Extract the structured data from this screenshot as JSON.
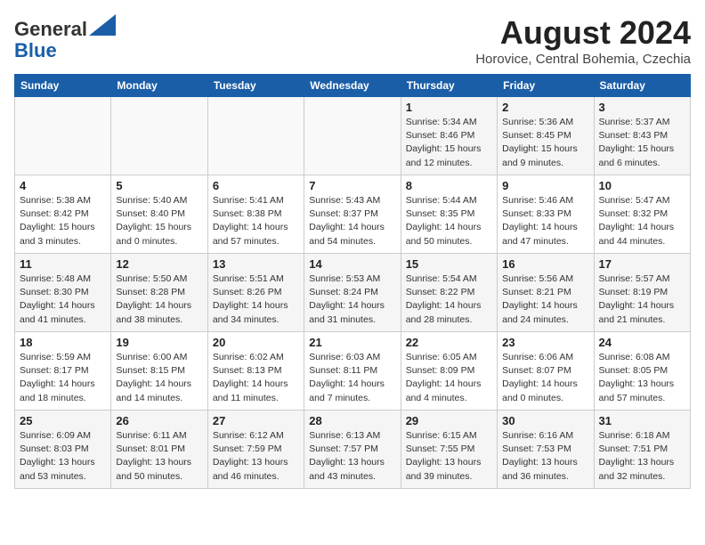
{
  "header": {
    "logo_line1": "General",
    "logo_line2": "Blue",
    "title": "August 2024",
    "subtitle": "Horovice, Central Bohemia, Czechia"
  },
  "weekdays": [
    "Sunday",
    "Monday",
    "Tuesday",
    "Wednesday",
    "Thursday",
    "Friday",
    "Saturday"
  ],
  "weeks": [
    [
      {
        "day": "",
        "info": ""
      },
      {
        "day": "",
        "info": ""
      },
      {
        "day": "",
        "info": ""
      },
      {
        "day": "",
        "info": ""
      },
      {
        "day": "1",
        "info": "Sunrise: 5:34 AM\nSunset: 8:46 PM\nDaylight: 15 hours\nand 12 minutes."
      },
      {
        "day": "2",
        "info": "Sunrise: 5:36 AM\nSunset: 8:45 PM\nDaylight: 15 hours\nand 9 minutes."
      },
      {
        "day": "3",
        "info": "Sunrise: 5:37 AM\nSunset: 8:43 PM\nDaylight: 15 hours\nand 6 minutes."
      }
    ],
    [
      {
        "day": "4",
        "info": "Sunrise: 5:38 AM\nSunset: 8:42 PM\nDaylight: 15 hours\nand 3 minutes."
      },
      {
        "day": "5",
        "info": "Sunrise: 5:40 AM\nSunset: 8:40 PM\nDaylight: 15 hours\nand 0 minutes."
      },
      {
        "day": "6",
        "info": "Sunrise: 5:41 AM\nSunset: 8:38 PM\nDaylight: 14 hours\nand 57 minutes."
      },
      {
        "day": "7",
        "info": "Sunrise: 5:43 AM\nSunset: 8:37 PM\nDaylight: 14 hours\nand 54 minutes."
      },
      {
        "day": "8",
        "info": "Sunrise: 5:44 AM\nSunset: 8:35 PM\nDaylight: 14 hours\nand 50 minutes."
      },
      {
        "day": "9",
        "info": "Sunrise: 5:46 AM\nSunset: 8:33 PM\nDaylight: 14 hours\nand 47 minutes."
      },
      {
        "day": "10",
        "info": "Sunrise: 5:47 AM\nSunset: 8:32 PM\nDaylight: 14 hours\nand 44 minutes."
      }
    ],
    [
      {
        "day": "11",
        "info": "Sunrise: 5:48 AM\nSunset: 8:30 PM\nDaylight: 14 hours\nand 41 minutes."
      },
      {
        "day": "12",
        "info": "Sunrise: 5:50 AM\nSunset: 8:28 PM\nDaylight: 14 hours\nand 38 minutes."
      },
      {
        "day": "13",
        "info": "Sunrise: 5:51 AM\nSunset: 8:26 PM\nDaylight: 14 hours\nand 34 minutes."
      },
      {
        "day": "14",
        "info": "Sunrise: 5:53 AM\nSunset: 8:24 PM\nDaylight: 14 hours\nand 31 minutes."
      },
      {
        "day": "15",
        "info": "Sunrise: 5:54 AM\nSunset: 8:22 PM\nDaylight: 14 hours\nand 28 minutes."
      },
      {
        "day": "16",
        "info": "Sunrise: 5:56 AM\nSunset: 8:21 PM\nDaylight: 14 hours\nand 24 minutes."
      },
      {
        "day": "17",
        "info": "Sunrise: 5:57 AM\nSunset: 8:19 PM\nDaylight: 14 hours\nand 21 minutes."
      }
    ],
    [
      {
        "day": "18",
        "info": "Sunrise: 5:59 AM\nSunset: 8:17 PM\nDaylight: 14 hours\nand 18 minutes."
      },
      {
        "day": "19",
        "info": "Sunrise: 6:00 AM\nSunset: 8:15 PM\nDaylight: 14 hours\nand 14 minutes."
      },
      {
        "day": "20",
        "info": "Sunrise: 6:02 AM\nSunset: 8:13 PM\nDaylight: 14 hours\nand 11 minutes."
      },
      {
        "day": "21",
        "info": "Sunrise: 6:03 AM\nSunset: 8:11 PM\nDaylight: 14 hours\nand 7 minutes."
      },
      {
        "day": "22",
        "info": "Sunrise: 6:05 AM\nSunset: 8:09 PM\nDaylight: 14 hours\nand 4 minutes."
      },
      {
        "day": "23",
        "info": "Sunrise: 6:06 AM\nSunset: 8:07 PM\nDaylight: 14 hours\nand 0 minutes."
      },
      {
        "day": "24",
        "info": "Sunrise: 6:08 AM\nSunset: 8:05 PM\nDaylight: 13 hours\nand 57 minutes."
      }
    ],
    [
      {
        "day": "25",
        "info": "Sunrise: 6:09 AM\nSunset: 8:03 PM\nDaylight: 13 hours\nand 53 minutes."
      },
      {
        "day": "26",
        "info": "Sunrise: 6:11 AM\nSunset: 8:01 PM\nDaylight: 13 hours\nand 50 minutes."
      },
      {
        "day": "27",
        "info": "Sunrise: 6:12 AM\nSunset: 7:59 PM\nDaylight: 13 hours\nand 46 minutes."
      },
      {
        "day": "28",
        "info": "Sunrise: 6:13 AM\nSunset: 7:57 PM\nDaylight: 13 hours\nand 43 minutes."
      },
      {
        "day": "29",
        "info": "Sunrise: 6:15 AM\nSunset: 7:55 PM\nDaylight: 13 hours\nand 39 minutes."
      },
      {
        "day": "30",
        "info": "Sunrise: 6:16 AM\nSunset: 7:53 PM\nDaylight: 13 hours\nand 36 minutes."
      },
      {
        "day": "31",
        "info": "Sunrise: 6:18 AM\nSunset: 7:51 PM\nDaylight: 13 hours\nand 32 minutes."
      }
    ]
  ]
}
